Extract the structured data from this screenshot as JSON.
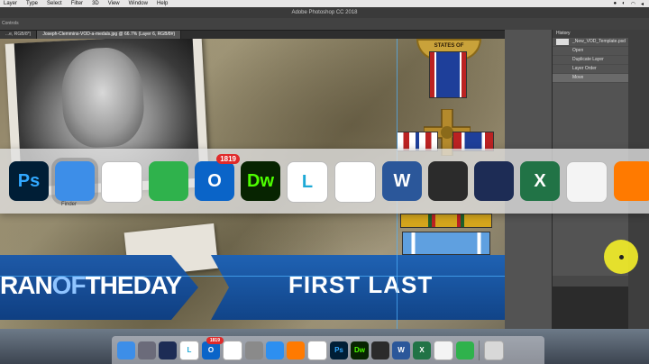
{
  "menubar": {
    "items": [
      "Layer",
      "Type",
      "Select",
      "Filter",
      "3D",
      "View",
      "Window",
      "Help"
    ]
  },
  "titlebar": {
    "title": "Adobe Photoshop CC 2018"
  },
  "optionsbar": {
    "label": "Controls"
  },
  "tabs": [
    {
      "label": "...e, RGB/8*)"
    },
    {
      "label": "Joseph-Clemmins-VOD-a-medals.jpg @ 66.7% (Layer 6, RGB/8#)"
    }
  ],
  "canvas": {
    "seal_text": "STATES OF",
    "banner_left": {
      "part1": "RAN",
      "part2": "OF",
      "part3": "THEDAY"
    },
    "banner_right": "FIRST LAST"
  },
  "history": {
    "title": "History",
    "snapshot": "_New_VOD_Template.psd",
    "steps": [
      "Open",
      "Duplicate Layer",
      "Layer Order",
      "Move"
    ]
  },
  "bigdock": {
    "items": [
      {
        "name": "photoshop-icon",
        "label": "Ps",
        "color": "#001e36",
        "text": "#31a8ff"
      },
      {
        "name": "finder-icon",
        "label": "",
        "color": "#3d8ee8"
      },
      {
        "name": "chrome-icon",
        "label": "",
        "color": "#ffffff"
      },
      {
        "name": "camtasia-icon",
        "label": "",
        "color": "#2fb24c"
      },
      {
        "name": "outlook-icon",
        "label": "O",
        "color": "#0a64c8",
        "badge": "1819"
      },
      {
        "name": "dreamweaver-icon",
        "label": "Dw",
        "color": "#072401",
        "text": "#4dff00"
      },
      {
        "name": "lynda-icon",
        "label": "L",
        "color": "#ffffff",
        "text": "#1ea9d6"
      },
      {
        "name": "vpn-globe-icon",
        "label": "",
        "color": "#ffffff"
      },
      {
        "name": "word-icon",
        "label": "W",
        "color": "#2b579a"
      },
      {
        "name": "acrobat-icon",
        "label": "",
        "color": "#2b2b2b"
      },
      {
        "name": "va-seal-icon",
        "label": "",
        "color": "#1d2c55"
      },
      {
        "name": "excel-icon",
        "label": "X",
        "color": "#217346"
      },
      {
        "name": "textedit-icon",
        "label": "",
        "color": "#f4f4f4"
      },
      {
        "name": "firefox-icon",
        "label": "",
        "color": "#ff7a00"
      }
    ],
    "selected_label": "Finder"
  },
  "dock": {
    "items": [
      {
        "name": "finder-dock-icon",
        "color": "#3d8ee8",
        "label": ""
      },
      {
        "name": "launchpad-dock-icon",
        "color": "#6b6b7a",
        "label": ""
      },
      {
        "name": "va-dock-icon",
        "color": "#1d2c55",
        "label": ""
      },
      {
        "name": "lynda-dock-icon",
        "color": "#ffffff",
        "label": "L",
        "text": "#1ea9d6"
      },
      {
        "name": "outlook-dock-icon",
        "color": "#0a64c8",
        "label": "O",
        "badge": "1819"
      },
      {
        "name": "vpn-dock-icon",
        "color": "#ffffff",
        "label": ""
      },
      {
        "name": "system-prefs-dock-icon",
        "color": "#8a8a8a",
        "label": ""
      },
      {
        "name": "safari-dock-icon",
        "color": "#2d8ff0",
        "label": ""
      },
      {
        "name": "firefox-dock-icon",
        "color": "#ff7a00",
        "label": ""
      },
      {
        "name": "chrome-dock-icon",
        "color": "#ffffff",
        "label": ""
      },
      {
        "name": "photoshop-dock-icon",
        "color": "#001e36",
        "label": "Ps",
        "text": "#31a8ff"
      },
      {
        "name": "dreamweaver-dock-icon",
        "color": "#072401",
        "label": "Dw",
        "text": "#4dff00"
      },
      {
        "name": "acrobat-dock-icon",
        "color": "#2b2b2b",
        "label": ""
      },
      {
        "name": "word-dock-icon",
        "color": "#2b579a",
        "label": "W"
      },
      {
        "name": "excel-dock-icon",
        "color": "#217346",
        "label": "X"
      },
      {
        "name": "textedit-dock-icon",
        "color": "#f4f4f4",
        "label": ""
      },
      {
        "name": "camtasia-dock-icon",
        "color": "#2fb24c",
        "label": ""
      },
      {
        "name": "trash-dock-icon",
        "color": "#d8d8d8",
        "label": ""
      }
    ]
  }
}
